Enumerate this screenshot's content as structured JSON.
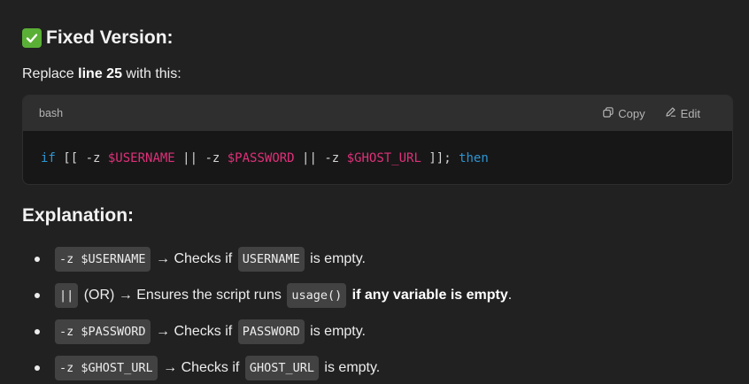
{
  "heading_fixed": "Fixed Version:",
  "intro": {
    "prefix": "Replace ",
    "bold": "line 25",
    "suffix": " with this:"
  },
  "codeblock": {
    "language": "bash",
    "copy_label": "Copy",
    "edit_label": "Edit",
    "tokens": {
      "if": "if",
      "open": " [[ -z ",
      "var1": "$USERNAME",
      "or1": " || -z ",
      "var2": "$PASSWORD",
      "or2": " || -z ",
      "var3": "$GHOST_URL",
      "close": " ]]; ",
      "then": "then"
    }
  },
  "heading_explanation": "Explanation:",
  "explanations": [
    {
      "code": "-z $USERNAME",
      "text1": " → Checks if ",
      "code2": "USERNAME",
      "text2": " is empty."
    },
    {
      "code": "||",
      "text1": " (OR) → Ensures the script runs ",
      "code2": "usage()",
      "bold": " if any variable is empty",
      "text2": "."
    },
    {
      "code": "-z $PASSWORD",
      "text1": " → Checks if ",
      "code2": "PASSWORD",
      "text2": " is empty."
    },
    {
      "code": "-z $GHOST_URL",
      "text1": " → Checks if ",
      "code2": "GHOST_URL",
      "text2": " is empty."
    }
  ],
  "colors": {
    "background": "#212121",
    "keyword": "#2e95d3",
    "variable": "#df3079",
    "check": "#5ab036"
  }
}
